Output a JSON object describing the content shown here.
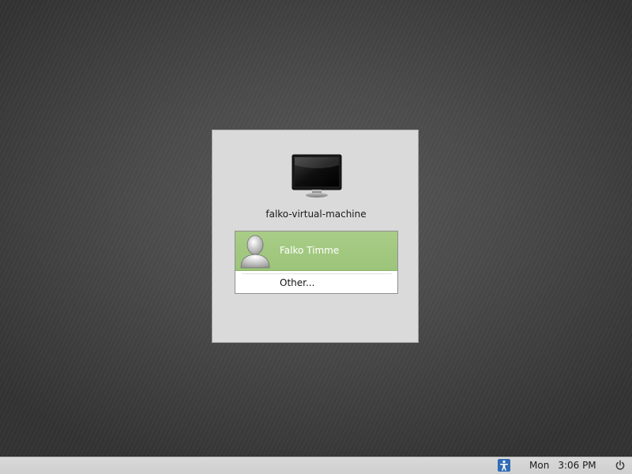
{
  "login": {
    "hostname": "falko-virtual-machine",
    "users": [
      {
        "name": "Falko Timme",
        "selected": true
      }
    ],
    "other_label": "Other..."
  },
  "panel": {
    "clock_day": "Mon",
    "clock_time": "3:06 PM",
    "icons": [
      "accessibility-icon",
      "power-icon"
    ]
  },
  "colors": {
    "selected_row": "#a9cd87",
    "panel_bg": "#dadada",
    "desktop_bg": "#4a4a4a"
  }
}
